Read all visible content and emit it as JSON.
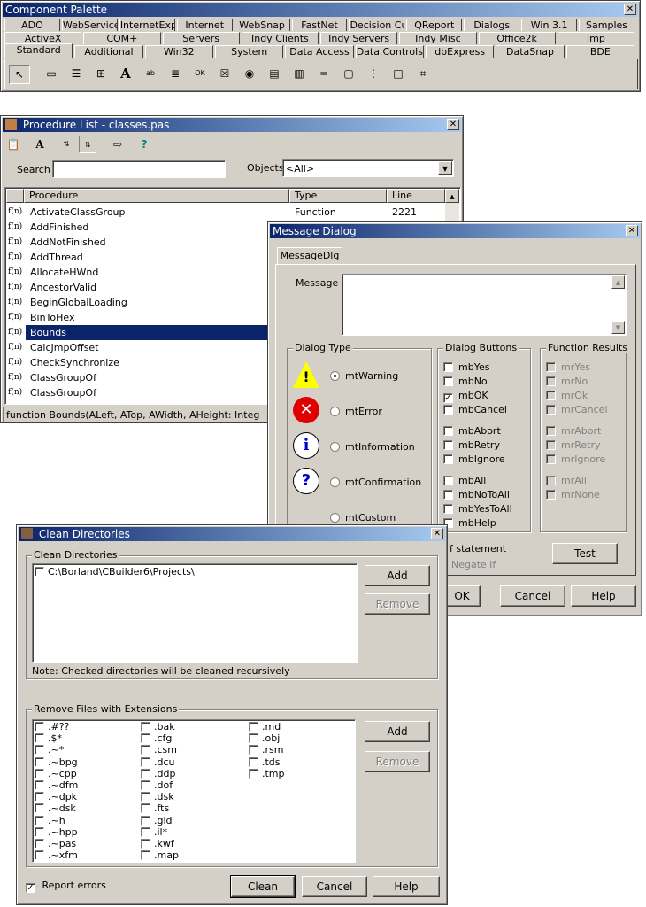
{
  "palette": {
    "title": "Component Palette",
    "tab_rows": [
      [
        "ADO",
        "WebServices",
        "InternetExpress",
        "Internet",
        "WebSnap",
        "FastNet",
        "Decision Cube",
        "QReport",
        "Dialogs",
        "Win 3.1",
        "Samples"
      ],
      [
        "ActiveX",
        "COM+",
        "Servers",
        "Indy Clients",
        "Indy Servers",
        "Indy Misc",
        "Office2k",
        "Imp"
      ],
      [
        "Standard",
        "Additional",
        "Win32",
        "System",
        "Data Access",
        "Data Controls",
        "dbExpress",
        "DataSnap",
        "BDE"
      ]
    ],
    "active_tab": "Standard",
    "components": [
      "pointer-icon",
      "frames-icon",
      "main-menu-icon",
      "popup-menu-icon",
      "label-icon",
      "edit-icon",
      "memo-icon",
      "button-icon",
      "checkbox-icon",
      "radio-button-icon",
      "listbox-icon",
      "combobox-icon",
      "scrollbar-icon",
      "groupbox-icon",
      "radiogroup-icon",
      "panel-icon",
      "action-list-icon"
    ]
  },
  "procedure_list": {
    "title": "Procedure List - classes.pas",
    "search_label": "Search",
    "search_value": "",
    "objects_label": "Objects",
    "objects_value": "<All>",
    "columns": [
      "Procedure",
      "Type",
      "Line"
    ],
    "rows": [
      {
        "name": "ActivateClassGroup",
        "type": "Function",
        "line": "2221"
      },
      {
        "name": "AddFinished",
        "type": "",
        "line": ""
      },
      {
        "name": "AddNotFinished",
        "type": "",
        "line": ""
      },
      {
        "name": "AddThread",
        "type": "",
        "line": ""
      },
      {
        "name": "AllocateHWnd",
        "type": "",
        "line": ""
      },
      {
        "name": "AncestorValid",
        "type": "",
        "line": ""
      },
      {
        "name": "BeginGlobalLoading",
        "type": "",
        "line": ""
      },
      {
        "name": "BinToHex",
        "type": "",
        "line": ""
      },
      {
        "name": "Bounds",
        "type": "",
        "line": ""
      },
      {
        "name": "CalcJmpOffset",
        "type": "",
        "line": ""
      },
      {
        "name": "CheckSynchronize",
        "type": "",
        "line": ""
      },
      {
        "name": "ClassGroupOf",
        "type": "",
        "line": ""
      },
      {
        "name": "ClassGroupOf",
        "type": "",
        "line": ""
      }
    ],
    "selected_row": 8,
    "row_icon_text": "f(n)",
    "status": "function Bounds(ALeft, ATop, AWidth, AHeight: Integ"
  },
  "message_dialog": {
    "title": "Message Dialog",
    "tab": "MessageDlg",
    "message_label": "Message",
    "message_value": "",
    "dialog_type_label": "Dialog Type",
    "dialog_types": [
      {
        "label": "mtWarning",
        "icon": "warning-icon",
        "checked": true
      },
      {
        "label": "mtError",
        "icon": "error-icon",
        "checked": false
      },
      {
        "label": "mtInformation",
        "icon": "information-icon",
        "checked": false
      },
      {
        "label": "mtConfirmation",
        "icon": "confirmation-icon",
        "checked": false
      },
      {
        "label": "mtCustom",
        "icon": "",
        "checked": false
      }
    ],
    "dialog_buttons_label": "Dialog Buttons",
    "dialog_buttons": [
      {
        "label": "mbYes",
        "checked": false
      },
      {
        "label": "mbNo",
        "checked": false
      },
      {
        "label": "mbOK",
        "checked": true
      },
      {
        "label": "mbCancel",
        "checked": false
      },
      {
        "label": "mbAbort",
        "checked": false
      },
      {
        "label": "mbRetry",
        "checked": false
      },
      {
        "label": "mbIgnore",
        "checked": false
      },
      {
        "label": "mbAll",
        "checked": false
      },
      {
        "label": "mbNoToAll",
        "checked": false
      },
      {
        "label": "mbYesToAll",
        "checked": false
      },
      {
        "label": "mbHelp",
        "checked": false
      }
    ],
    "function_results_label": "Function Results",
    "function_results": [
      "mrYes",
      "mrNo",
      "mrOk",
      "mrCancel",
      "mrAbort",
      "mrRetry",
      "mrIgnore",
      "mrAll",
      "mrNone"
    ],
    "if_statement_label": "f statement",
    "negate_if_label": "Negate if",
    "test_button": "Test",
    "ok_button": "OK",
    "cancel_button": "Cancel",
    "help_button": "Help"
  },
  "clean_dirs": {
    "title": "Clean Directories",
    "dirs_group_label": "Clean Directories",
    "directories": [
      {
        "path": "C:\\Borland\\CBuilder6\\Projects\\",
        "checked": false
      }
    ],
    "note": "Note: Checked directories will be cleaned recursively",
    "add_button": "Add",
    "remove_button": "Remove",
    "ext_group_label": "Remove Files with Extensions",
    "extensions": [
      [
        ".#??",
        ".$*",
        ".~*",
        ".~bpg",
        ".~cpp",
        ".~dfm",
        ".~dpk",
        ".~dsk",
        ".~h",
        ".~hpp",
        ".~pas",
        ".~xfm"
      ],
      [
        ".bak",
        ".cfg",
        ".csm",
        ".dcu",
        ".ddp",
        ".dof",
        ".dsk",
        ".fts",
        ".gid",
        ".il*",
        ".kwf",
        ".map"
      ],
      [
        ".md",
        ".obj",
        ".rsm",
        ".tds",
        ".tmp"
      ]
    ],
    "ext_add_button": "Add",
    "ext_remove_button": "Remove",
    "report_errors_label": "Report errors",
    "report_errors_checked": true,
    "clean_button": "Clean",
    "cancel_button": "Cancel",
    "help_button": "Help"
  }
}
